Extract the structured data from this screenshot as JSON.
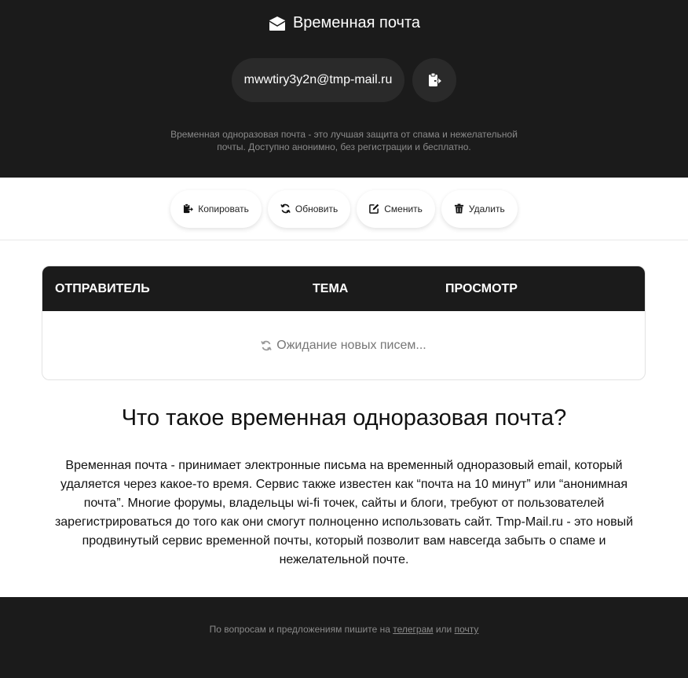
{
  "header": {
    "brand_icon": "envelope-open-icon",
    "brand_title": "Временная почта",
    "email": "mwwtiry3y2n@tmp-mail.ru",
    "copy_icon": "clipboard-icon",
    "tagline_line1": "Временная одноразовая почта - это лучшая защита от спама и нежелательной",
    "tagline_line2": "почты. Доступно анонимно, без регистрации и бесплатно."
  },
  "actions": [
    {
      "label": "Копировать",
      "icon": "clipboard-icon"
    },
    {
      "label": "Обновить",
      "icon": "refresh-icon"
    },
    {
      "label": "Сменить",
      "icon": "edit-icon"
    },
    {
      "label": "Удалить",
      "icon": "trash-icon"
    }
  ],
  "inbox": {
    "col_sender": "ОТПРАВИТЕЛЬ",
    "col_subject": "ТЕМА",
    "col_preview": "ПРОСМОТР",
    "waiting": "Ожидание новых писем..."
  },
  "about": {
    "title": "Что такое временная одноразовая почта?",
    "body": "Временная почта - принимает электронные письма на временный одноразовый email, который удаляется через какое-то время. Сервис также известен как “почта на 10 минут” или “анонимная почта”. Многие форумы, владельцы wi-fi точек, сайты и блоги, требуют от пользователей зарегистрироваться до того как они смогут полноценно использовать сайт. Tmp-Mail.ru - это новый продвинутый сервис временной почты, который позволит вам навсегда забыть о спаме и нежелательной почте."
  },
  "footer": {
    "text_before": "По вопросам и предложениям пишите на ",
    "link_telegram": "телеграм",
    "text_middle": " или ",
    "link_mail": "почту"
  },
  "colors": {
    "dark": "#1b1b1b",
    "pill": "#2a2a2a",
    "muted": "#8a8a8a"
  }
}
